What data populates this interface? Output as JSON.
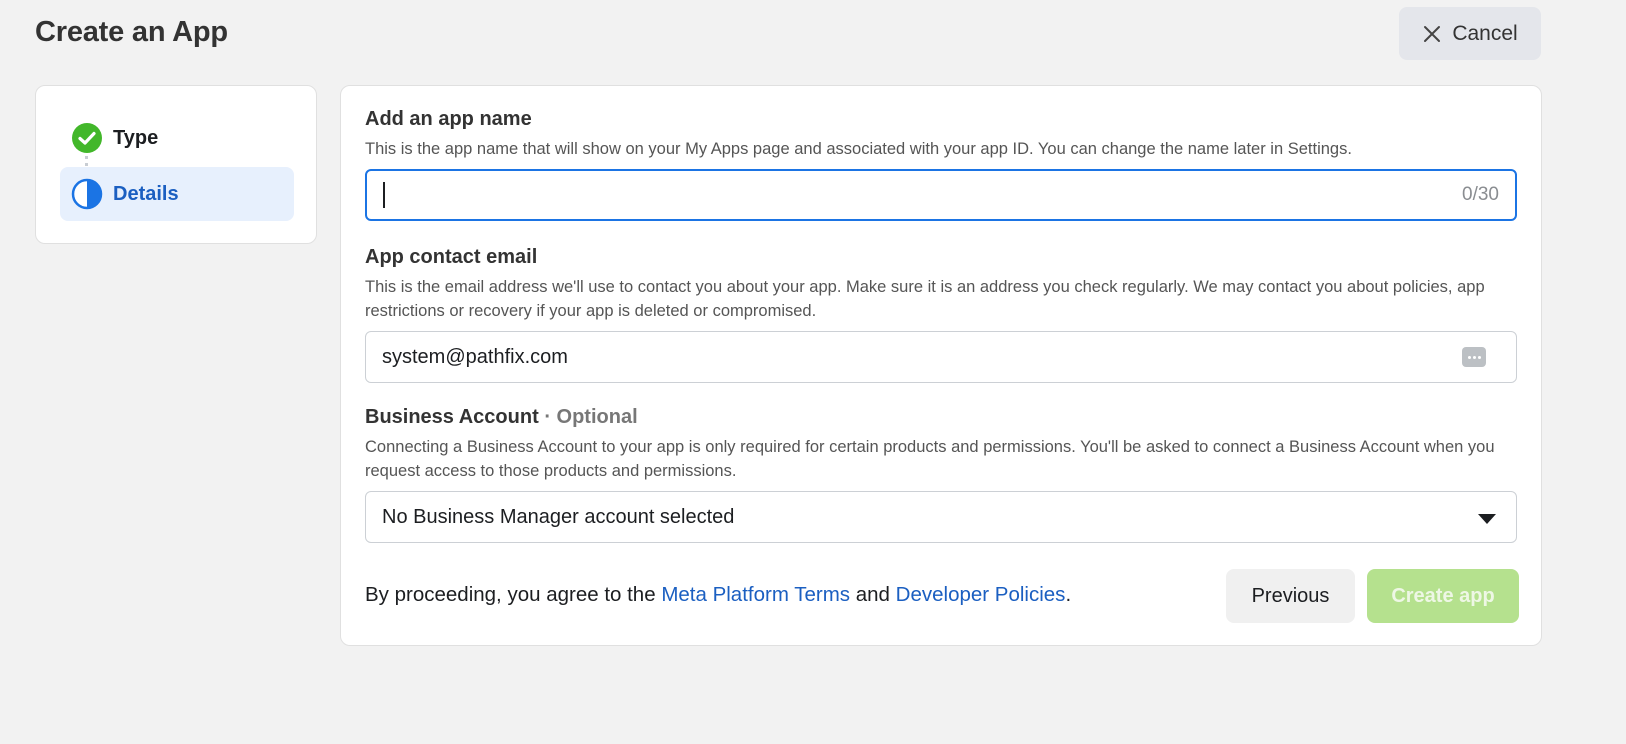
{
  "page": {
    "title": "Create an App",
    "cancel_label": "Cancel"
  },
  "stepper": {
    "steps": [
      {
        "label": "Type",
        "status": "complete"
      },
      {
        "label": "Details",
        "status": "current"
      }
    ]
  },
  "form": {
    "app_name": {
      "label": "Add an app name",
      "help": "This is the app name that will show on your My Apps page and associated with your app ID. You can change the name later in Settings.",
      "value": "",
      "counter": "0/30"
    },
    "contact_email": {
      "label": "App contact email",
      "help": "This is the email address we'll use to contact you about your app. Make sure it is an address you check regularly. We may contact you about policies, app restrictions or recovery if your app is deleted or compromised.",
      "value": "system@pathfix.com"
    },
    "business_account": {
      "label": "Business Account",
      "optional": "· Optional",
      "help": "Connecting a Business Account to your app is only required for certain products and permissions. You'll be asked to connect a Business Account when you request access to those products and permissions.",
      "selected": "No Business Manager account selected"
    }
  },
  "footer": {
    "text_before": "By proceeding, you agree to the ",
    "link_terms": "Meta Platform Terms",
    "text_and": " and ",
    "link_policies": "Developer Policies",
    "text_after": ".",
    "previous_label": "Previous",
    "create_label": "Create app"
  },
  "colors": {
    "accent": "#1b5fc1",
    "success": "#42b72a",
    "create_disabled": "#b5e18e"
  }
}
